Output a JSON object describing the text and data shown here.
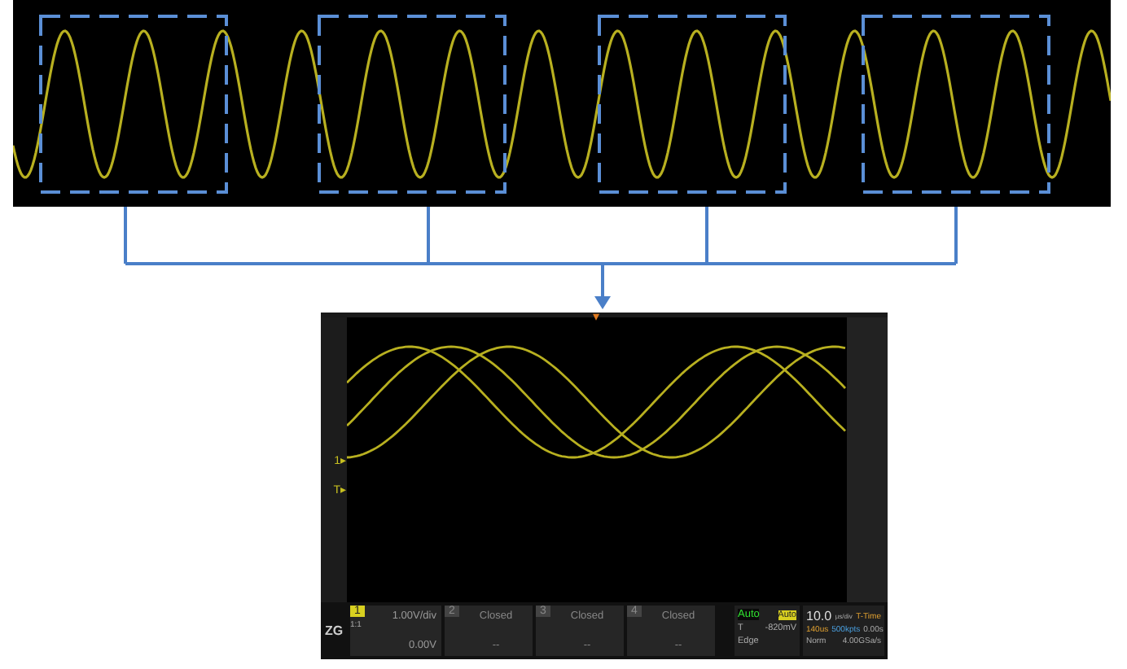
{
  "scope": {
    "trigger_marker": "▾",
    "markers": [
      "1▸",
      "T▸"
    ],
    "logo": "ZG",
    "channels": [
      {
        "kind": "active",
        "number": "1",
        "scale": "1.00V/div",
        "offset": "0.00V",
        "note": "1:1"
      },
      {
        "kind": "closed",
        "number": "2",
        "status": "Closed",
        "dashes": "--"
      },
      {
        "kind": "closed",
        "number": "3",
        "status": "Closed",
        "dashes": "--"
      },
      {
        "kind": "closed",
        "number": "4",
        "status": "Closed",
        "dashes": "--"
      }
    ],
    "trigger": {
      "mode": "Auto",
      "sweep": "Auto",
      "source": "T",
      "level": "-820mV",
      "type": "Edge"
    },
    "timebase": {
      "value": "10.0",
      "unit": "µs/div",
      "label": "T-Time",
      "delay": "0.00s",
      "span": "140us",
      "depth": "500kpts",
      "acq": "Norm",
      "rate": "4.00GSa/s"
    }
  }
}
